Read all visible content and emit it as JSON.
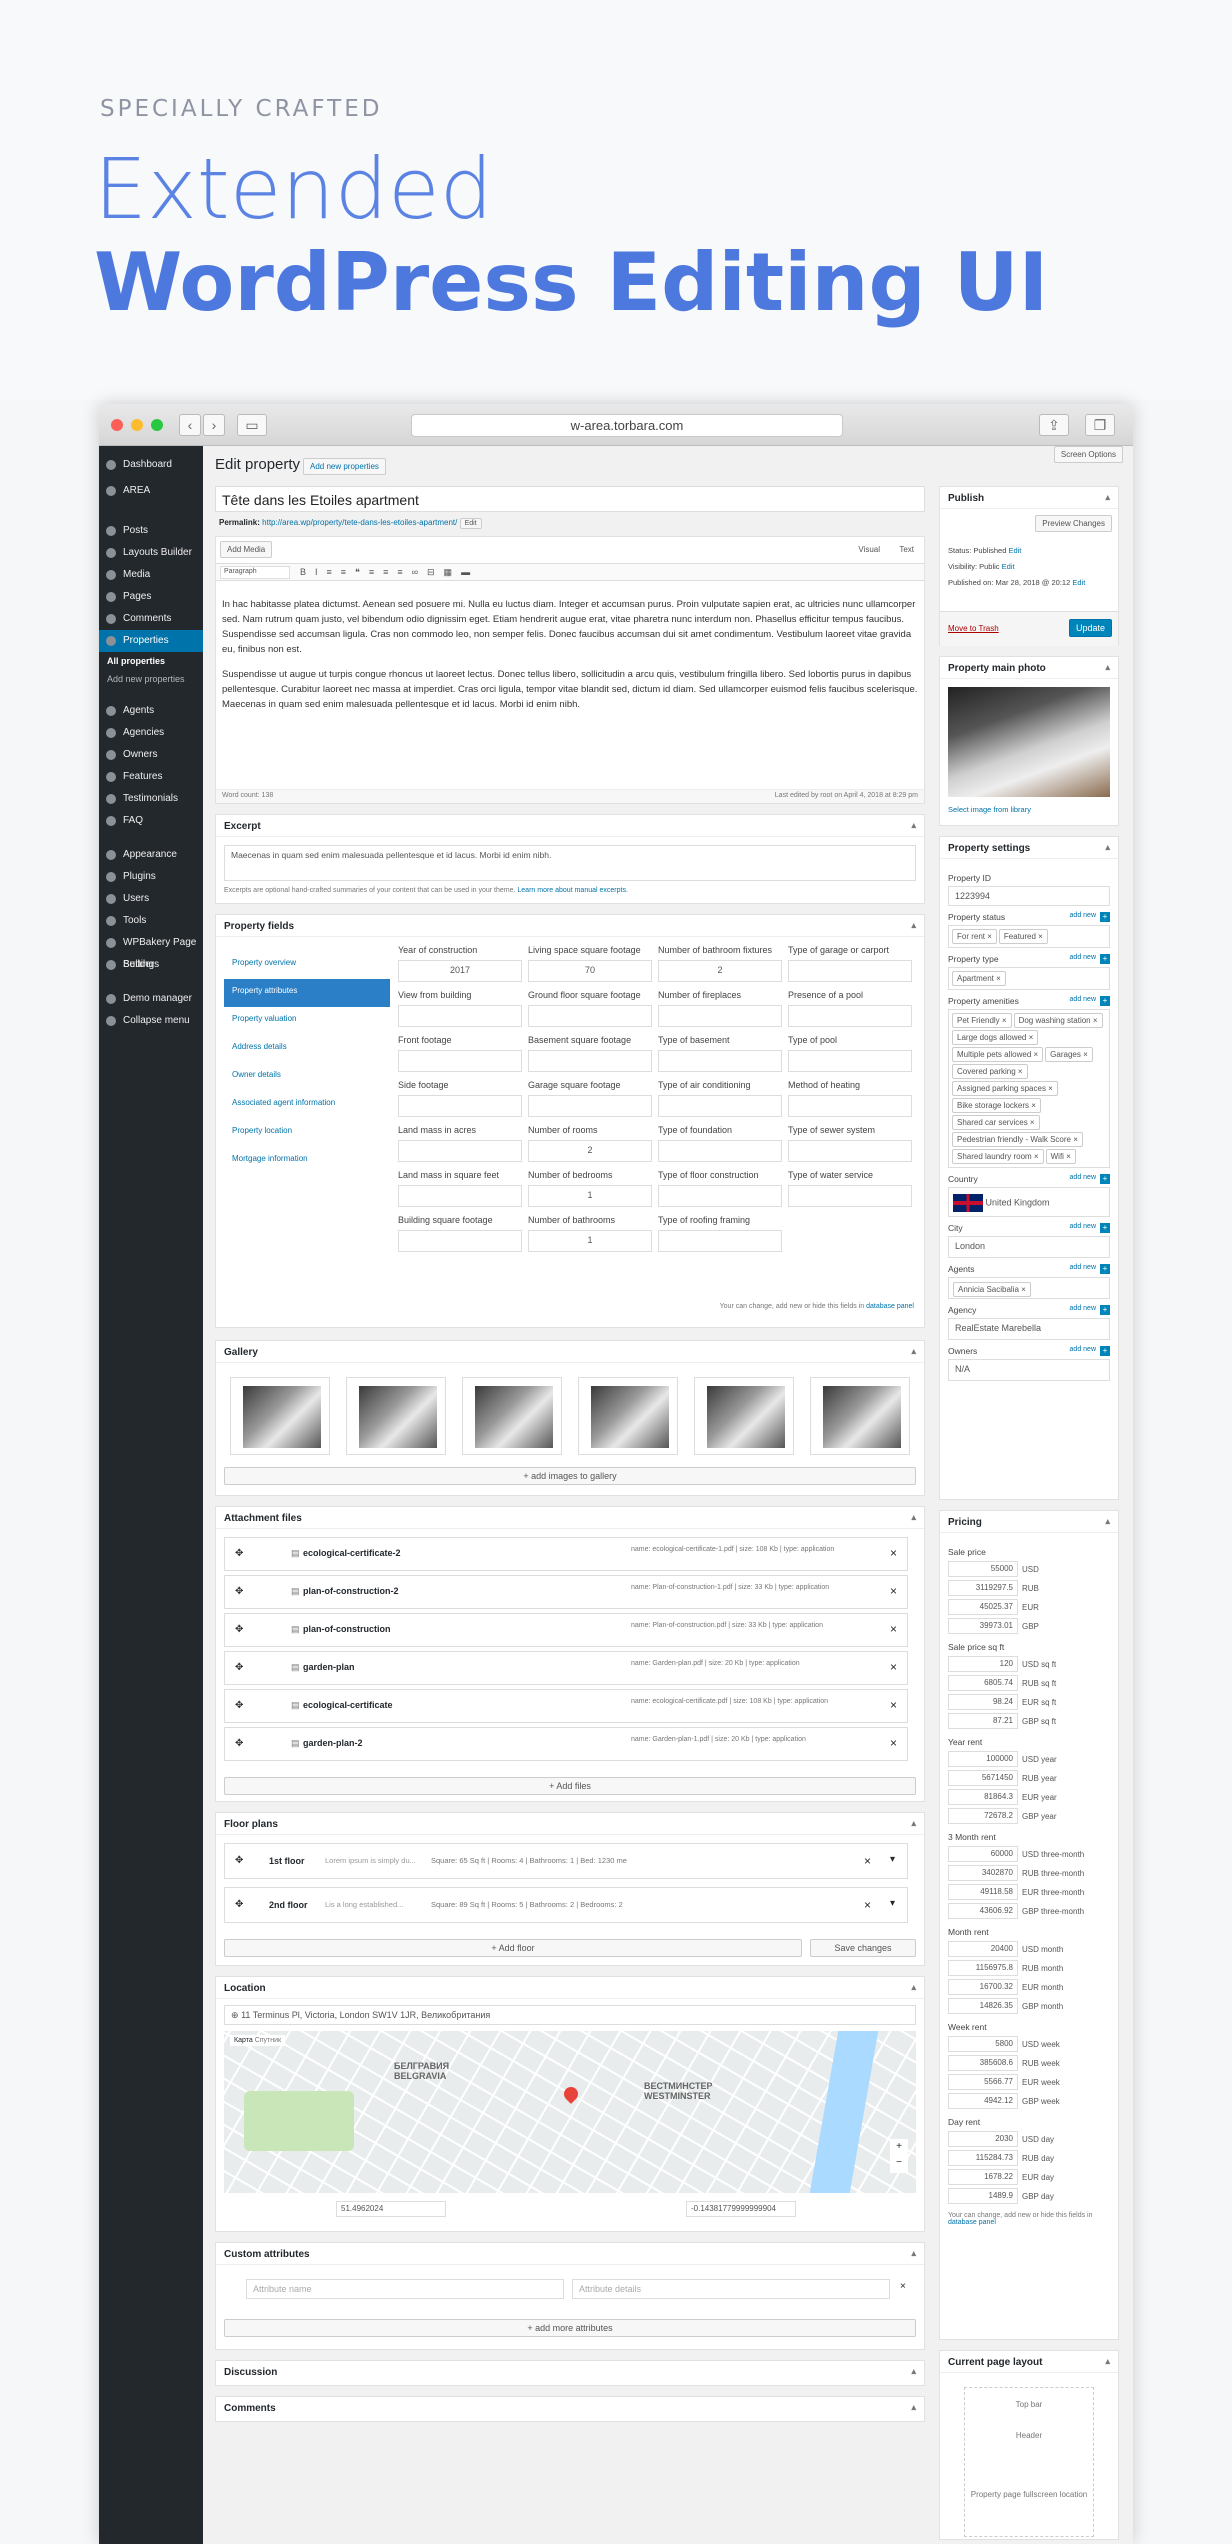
{
  "hero": {
    "kicker": "SPECIALLY CRAFTED",
    "line1": "Extended",
    "line2": "WordPress Editing UI"
  },
  "browser": {
    "url": "w-area.torbara.com"
  },
  "sidebar": {
    "items": [
      "Dashboard",
      "AREA",
      "Posts",
      "Layouts Builder",
      "Media",
      "Pages",
      "Comments",
      "Properties",
      "Agents",
      "Agencies",
      "Owners",
      "Features",
      "Testimonials",
      "FAQ",
      "Appearance",
      "Plugins",
      "Users",
      "Tools",
      "WPBakery Page Builder",
      "Settings",
      "Demo manager",
      "Collapse menu"
    ],
    "sub": [
      "All properties",
      "Add new properties"
    ]
  },
  "header": {
    "title": "Edit property",
    "add_new": "Add new properties",
    "screen_options": "Screen Options"
  },
  "post": {
    "title": "Tête dans les Etoiles apartment",
    "permalink_label": "Permalink:",
    "permalink": "http://area.wp/property/tete-dans-les-etoiles-apartment/",
    "edit": "Edit",
    "add_media": "Add Media",
    "visual": "Visual",
    "text": "Text",
    "format": "Paragraph",
    "body1": "In hac habitasse platea dictumst. Aenean sed posuere mi. Nulla eu luctus diam. Integer et accumsan purus. Proin vulputate sapien erat, ac ultricies nunc ullamcorper sed. Nam rutrum quam justo, vel bibendum odio dignissim eget. Etiam hendrerit augue erat, vitae pharetra nunc interdum non. Phasellus efficitur tempus faucibus. Suspendisse sed accumsan ligula. Cras non commodo leo, non semper felis. Donec faucibus accumsan dui sit amet condimentum. Vestibulum laoreet vitae gravida eu, finibus non est.",
    "body2": "Suspendisse ut augue ut turpis congue rhoncus ut laoreet lectus. Donec tellus libero, sollicitudin a arcu quis, vestibulum fringilla libero. Sed lobortis purus in dapibus pellentesque. Curabitur laoreet nec massa at imperdiet. Cras orci ligula, tempor vitae blandit sed, dictum id diam. Sed ullamcorper euismod felis faucibus scelerisque. Maecenas in quam sed enim malesuada pellentesque et id lacus. Morbi id enim nibh.",
    "word_count": "Word count: 138",
    "last_edited": "Last edited by root on April 4, 2018 at 8:29 pm"
  },
  "excerpt": {
    "title": "Excerpt",
    "text": "Maecenas in quam sed enim malesuada pellentesque et id lacus. Morbi id enim nibh.",
    "help": "Excerpts are optional hand-crafted summaries of your content that can be used in your theme.",
    "help_link": "Learn more about manual excerpts."
  },
  "fields": {
    "title": "Property fields",
    "tabs": [
      "Property overview",
      "Property attributes",
      "Property valuation",
      "Address details",
      "Owner details",
      "Associated agent information",
      "Property location",
      "Mortgage information"
    ],
    "cells": [
      [
        "Year of construction",
        "2017"
      ],
      [
        "Living space square footage",
        "70"
      ],
      [
        "Number of bathroom fixtures",
        "2"
      ],
      [
        "Type of garage or carport",
        ""
      ],
      [
        "View from building",
        ""
      ],
      [
        "Ground floor square footage",
        ""
      ],
      [
        "Number of fireplaces",
        ""
      ],
      [
        "Presence of a pool",
        ""
      ],
      [
        "Front footage",
        ""
      ],
      [
        "Basement square footage",
        ""
      ],
      [
        "Type of basement",
        ""
      ],
      [
        "Type of pool",
        ""
      ],
      [
        "Side footage",
        ""
      ],
      [
        "Garage square footage",
        ""
      ],
      [
        "Type of air conditioning",
        ""
      ],
      [
        "Method of heating",
        ""
      ],
      [
        "Land mass in acres",
        ""
      ],
      [
        "Number of rooms",
        "2"
      ],
      [
        "Type of foundation",
        ""
      ],
      [
        "Type of sewer system",
        ""
      ],
      [
        "Land mass in square feet",
        ""
      ],
      [
        "Number of bedrooms",
        "1"
      ],
      [
        "Type of floor construction",
        ""
      ],
      [
        "Type of water service",
        ""
      ],
      [
        "Building square footage",
        ""
      ],
      [
        "Number of bathrooms",
        "1"
      ],
      [
        "Type of roofing framing",
        ""
      ]
    ],
    "note": "Your can change, add new or hide this fields in",
    "note_link": "database panel"
  },
  "gallery": {
    "title": "Gallery",
    "add": "+ add images to gallery"
  },
  "attachments": {
    "title": "Attachment files",
    "rows": [
      [
        "ecological-certificate-2",
        "ecological-certificate-1.pdf",
        "108 Kb"
      ],
      [
        "plan-of-construction-2",
        "Plan-of-construction-1.pdf",
        "33 Kb"
      ],
      [
        "plan-of-construction",
        "Plan-of-construction.pdf",
        "33 Kb"
      ],
      [
        "garden-plan",
        "Garden-plan.pdf",
        "20 Kb"
      ],
      [
        "ecological-certificate",
        "ecological-certificate.pdf",
        "108 Kb"
      ],
      [
        "garden-plan-2",
        "Garden-plan-1.pdf",
        "20 Kb"
      ]
    ],
    "add": "+ Add files"
  },
  "floors": {
    "title": "Floor plans",
    "rows": [
      [
        "1st floor",
        "Lorem ipsum is simply du...",
        "Square: 65 Sq ft | Rooms: 4 | Bathrooms: 1 | Bed: 1230 me"
      ],
      [
        "2nd floor",
        "Lis a long established...",
        "Square: 89 Sq ft | Rooms: 5 | Bathrooms: 2 | Bedrooms: 2"
      ]
    ],
    "add": "+ Add floor",
    "save": "Save changes"
  },
  "location": {
    "title": "Location",
    "address": "11 Terminus Pl, Victoria, London SW1V 1JR, Великобритания",
    "lat": "51.4962024",
    "lng": "-0.14381779999999904",
    "map": "Карта",
    "sat": "Спутник",
    "area1": "БЕЛГРАВИЯ",
    "area2": "BELGRAVIA",
    "area3": "ВЕСТМИНСТЕР",
    "area4": "WESTMINSTER"
  },
  "custom": {
    "title": "Custom attributes",
    "name_ph": "Attribute name",
    "det_ph": "Attribute details",
    "add": "+ add more attributes"
  },
  "discussion": "Discussion",
  "comments": "Comments",
  "publish": {
    "title": "Publish",
    "preview": "Preview Changes",
    "status": "Status: Published",
    "visibility": "Visibility: Public",
    "published": "Published on: Mar 28, 2018 @ 20:12",
    "edit": "Edit",
    "trash": "Move to Trash",
    "update": "Update"
  },
  "photo": {
    "title": "Property main photo",
    "select": "Select image from library"
  },
  "settings": {
    "title": "Property settings",
    "id_label": "Property ID",
    "id": "1223994",
    "status_label": "Property status",
    "statuses": [
      "For rent",
      "Featured"
    ],
    "type_label": "Property type",
    "type": "Apartment",
    "amen_label": "Property amenities",
    "amenities": [
      "Pet Friendly",
      "Dog washing station",
      "Large dogs allowed",
      "Multiple pets allowed",
      "Garages",
      "Covered parking",
      "Assigned parking spaces",
      "Bike storage lockers",
      "Shared car services",
      "Pedestrian friendly - Walk Score",
      "Shared laundry room",
      "Wifi"
    ],
    "country_label": "Country",
    "country": "United Kingdom",
    "city_label": "City",
    "city": "London",
    "agents_label": "Agents",
    "agent": "Annicia Sacibalia",
    "agency_label": "Agency",
    "agency": "RealEstate Marebella",
    "owners_label": "Owners",
    "owner": "N/A",
    "add_new": "add new"
  },
  "pricing": {
    "title": "Pricing",
    "groups": [
      [
        "Sale price",
        [
          [
            "55000",
            "USD"
          ],
          [
            "3119297.5",
            "RUB"
          ],
          [
            "45025.37",
            "EUR"
          ],
          [
            "39973.01",
            "GBP"
          ]
        ]
      ],
      [
        "Sale price sq ft",
        [
          [
            "120",
            "USD sq ft"
          ],
          [
            "6805.74",
            "RUB sq ft"
          ],
          [
            "98.24",
            "EUR sq ft"
          ],
          [
            "87.21",
            "GBP sq ft"
          ]
        ]
      ],
      [
        "Year rent",
        [
          [
            "100000",
            "USD year"
          ],
          [
            "5671450",
            "RUB year"
          ],
          [
            "81864.3",
            "EUR year"
          ],
          [
            "72678.2",
            "GBP year"
          ]
        ]
      ],
      [
        "3 Month rent",
        [
          [
            "60000",
            "USD three-month"
          ],
          [
            "3402870",
            "RUB three-month"
          ],
          [
            "49118.58",
            "EUR three-month"
          ],
          [
            "43606.92",
            "GBP three-month"
          ]
        ]
      ],
      [
        "Month rent",
        [
          [
            "20400",
            "USD month"
          ],
          [
            "1156975.8",
            "RUB month"
          ],
          [
            "16700.32",
            "EUR month"
          ],
          [
            "14826.35",
            "GBP month"
          ]
        ]
      ],
      [
        "Week rent",
        [
          [
            "5800",
            "USD week"
          ],
          [
            "385608.6",
            "RUB week"
          ],
          [
            "5566.77",
            "EUR week"
          ],
          [
            "4942.12",
            "GBP week"
          ]
        ]
      ],
      [
        "Day rent",
        [
          [
            "2030",
            "USD day"
          ],
          [
            "115284.73",
            "RUB day"
          ],
          [
            "1678.22",
            "EUR day"
          ],
          [
            "1489.9",
            "GBP day"
          ]
        ]
      ]
    ],
    "note": "Your can change, add new or hide this fields in",
    "note_link": "database panel"
  },
  "layout": {
    "title": "Current page layout",
    "top": "Top bar",
    "header": "Header",
    "fullscreen": "Property page fullscreen location"
  }
}
